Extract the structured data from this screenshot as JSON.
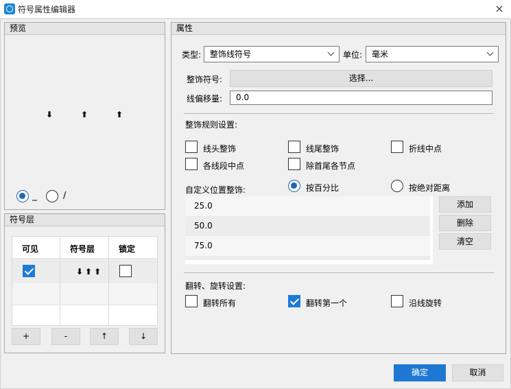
{
  "window": {
    "title": "符号属性编辑器",
    "close_glyph": "×"
  },
  "preview": {
    "header": "预览",
    "arrows": [
      "⬇",
      "⬆",
      "⬆"
    ],
    "radio1_label": "_",
    "radio2_label": "/",
    "selected_radio": 1
  },
  "layers": {
    "header": "符号层",
    "columns": [
      "可见",
      "符号层",
      "锁定"
    ],
    "rows": [
      {
        "visible": true,
        "symbol": "⬇⬆⬆",
        "locked": false
      }
    ],
    "buttons": [
      "+",
      "-",
      "↑",
      "↓"
    ]
  },
  "props": {
    "header": "属性",
    "type_label": "类型:",
    "type_value": "整饰线符号",
    "unit_label": "单位:",
    "unit_value": "毫米",
    "deco_symbol_label": "整饰符号:",
    "choose_button": "选择...",
    "offset_label": "线偏移量:",
    "offset_value": "0.0",
    "rules_title": "整饰规则设置:",
    "rules": [
      {
        "label": "线头整饰",
        "checked": false
      },
      {
        "label": "线尾整饰",
        "checked": false
      },
      {
        "label": "折线中点",
        "checked": false
      },
      {
        "label": "各线段中点",
        "checked": false
      },
      {
        "label": "除首尾各节点",
        "checked": false
      }
    ],
    "custom_label": "自定义位置整饰:",
    "mode_percent": "按百分比",
    "mode_absolute": "按绝对距离",
    "mode_selected": "percent",
    "positions": [
      "25.0",
      "50.0",
      "75.0"
    ],
    "list_buttons": [
      "添加",
      "删除",
      "清空"
    ],
    "flip_title": "翻转、旋转设置:",
    "flips": [
      {
        "label": "翻转所有",
        "checked": false
      },
      {
        "label": "翻转第一个",
        "checked": true
      },
      {
        "label": "沿线旋转",
        "checked": false
      }
    ]
  },
  "footer": {
    "ok": "确定",
    "cancel": "取消"
  },
  "colors": {
    "accent": "#1e78d3",
    "panel_bg": "#f0f0f0"
  }
}
